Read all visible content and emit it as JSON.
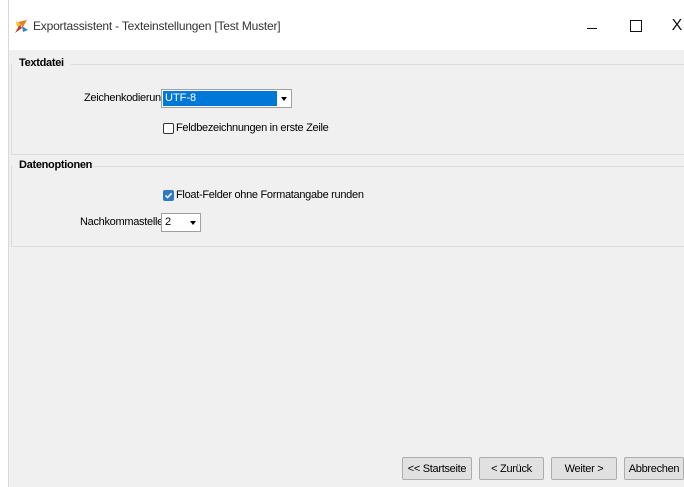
{
  "window": {
    "title": "Exportassistent - Texteinstellungen [Test Muster]",
    "controls": {
      "minimize": "–",
      "maximize": "□",
      "close": "X"
    }
  },
  "textdatei": {
    "heading": "Textdatei",
    "encoding_label": "Zeichenkodierung",
    "encoding_value": "UTF-8",
    "header_checkbox_label": "Feldbezeichnungen in erste Zeile",
    "header_checkbox_checked": false
  },
  "datenoptionen": {
    "heading": "Datenoptionen",
    "float_checkbox_label": "Float-Felder ohne Formatangabe runden",
    "float_checkbox_checked": true,
    "decimals_label": "Nachkommastellen",
    "decimals_value": "2"
  },
  "buttons": {
    "start": "<< Startseite",
    "back": "< Zurück",
    "next": "Weiter >",
    "cancel": "Abbrechen"
  },
  "colors": {
    "selection": "#0078d7",
    "checkbox_checked": "#2f78c5"
  }
}
